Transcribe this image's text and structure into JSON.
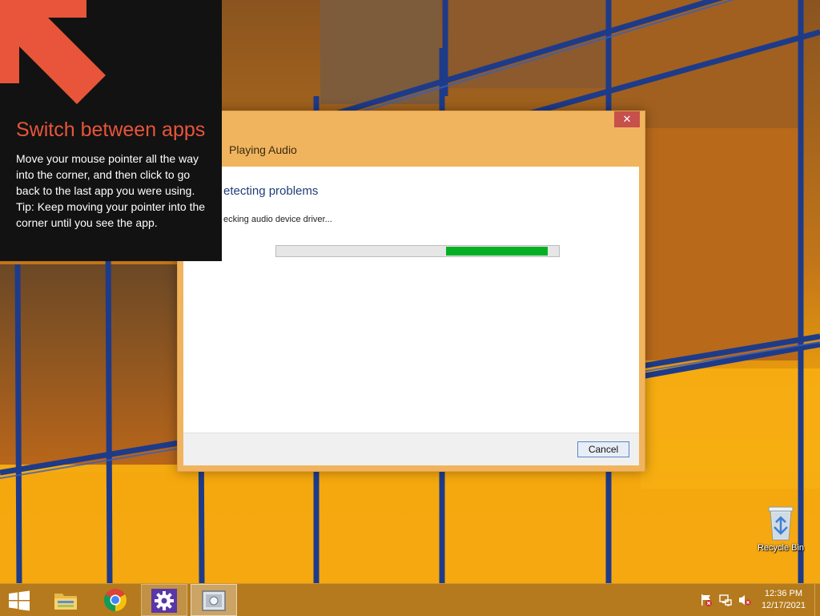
{
  "tip": {
    "title": "Switch between apps",
    "line1": "Move your mouse pointer all the way into the corner, and then click to go back to the last app you were using.",
    "line2": "Tip: Keep moving your pointer into the corner until you see the app.",
    "arrow_icon": "arrow-up-left-icon",
    "accent_color": "#e8553a"
  },
  "dialog": {
    "title": "Playing Audio",
    "close_label": "✕",
    "heading": "etecting problems",
    "status": "ecking audio device driver...",
    "progress": {
      "start_fraction": 0.6,
      "end_fraction": 0.96,
      "color": "#06b025"
    },
    "cancel_label": "Cancel"
  },
  "desktop": {
    "recycle_bin_label": "Recycle Bin"
  },
  "taskbar": {
    "buttons": [
      {
        "name": "start-button",
        "icon": "windows-logo-icon"
      },
      {
        "name": "file-explorer",
        "icon": "folder-icon"
      },
      {
        "name": "chrome",
        "icon": "chrome-icon"
      },
      {
        "name": "settings",
        "icon": "gear-icon"
      },
      {
        "name": "troubleshooter",
        "icon": "troubleshooter-icon"
      }
    ],
    "tray": [
      "action-center-flag-icon",
      "network-icon",
      "speaker-muted-icon"
    ],
    "time": "12:36 PM",
    "date": "12/17/2021"
  }
}
